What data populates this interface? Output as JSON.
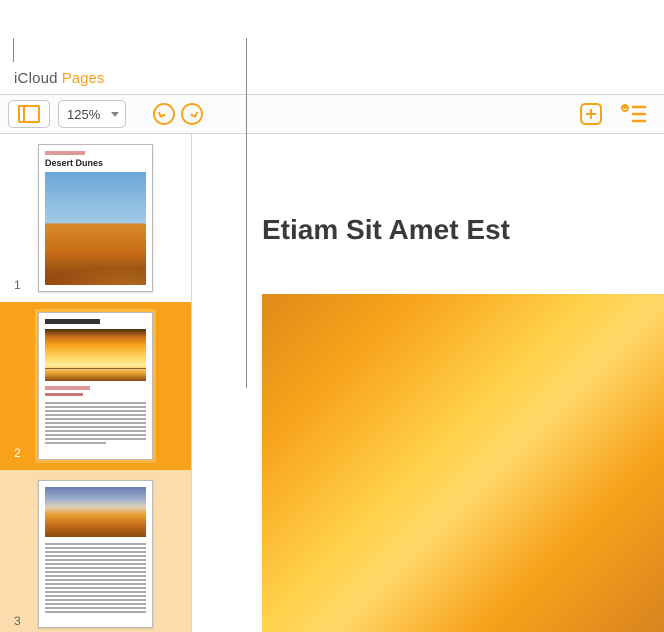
{
  "brand": {
    "icloud": "iCloud",
    "pages": "Pages"
  },
  "toolbar": {
    "zoom": "125%",
    "colors": {
      "accent": "#f7a21a"
    }
  },
  "sidebar": {
    "thumbs": [
      {
        "num": "1",
        "title": "Desert Dunes",
        "selected": false
      },
      {
        "num": "2",
        "title": "",
        "selected": true
      },
      {
        "num": "3",
        "title": "",
        "selected": false
      }
    ]
  },
  "document": {
    "heading": "Etiam Sit Amet Est"
  }
}
